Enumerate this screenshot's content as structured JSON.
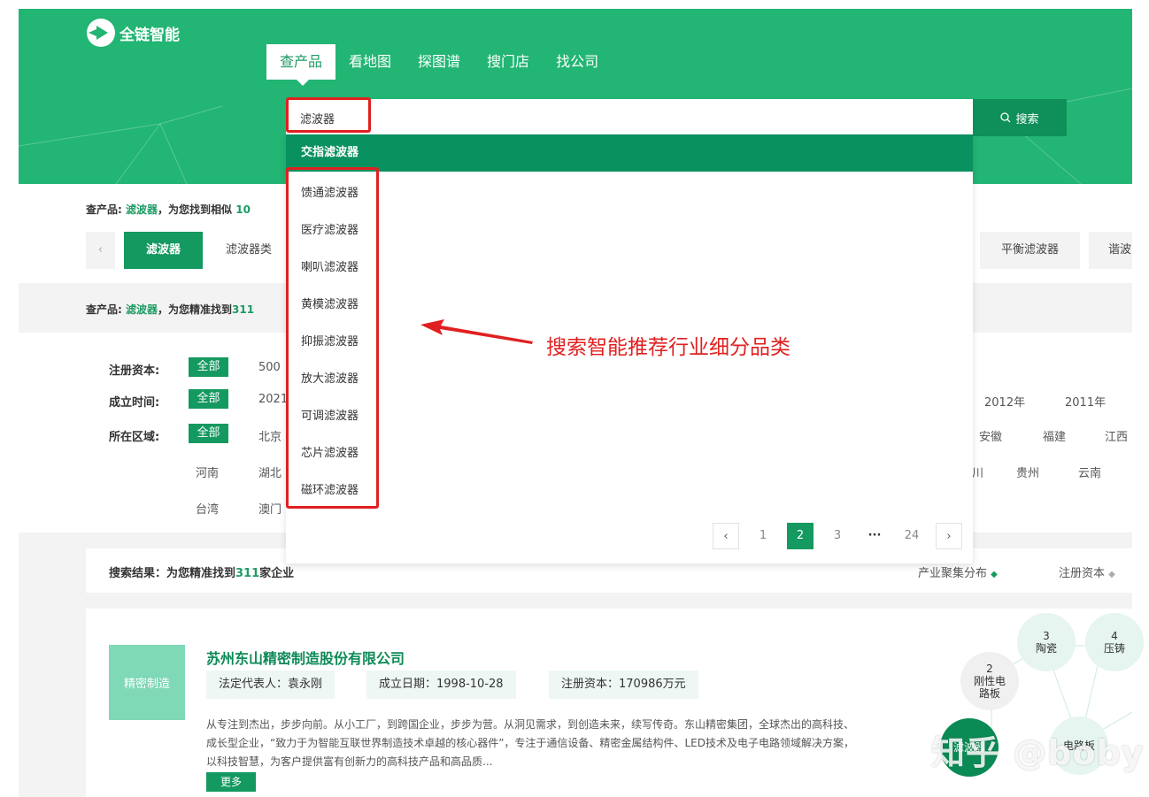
{
  "brand": {
    "logo_text": "全链智能",
    "accent": "#22b573",
    "dark_accent": "#149960",
    "annotation_color": "#e02020"
  },
  "nav": {
    "tabs": [
      "查产品",
      "看地图",
      "探图谱",
      "搜门店",
      "找公司"
    ]
  },
  "search": {
    "value": "滤波器",
    "button_label": "搜索"
  },
  "dropdown": {
    "highlighted": "交指滤波器",
    "items": [
      "馈通滤波器",
      "医疗滤波器",
      "喇叭滤波器",
      "黄模滤波器",
      "抑振滤波器",
      "放大滤波器",
      "可调滤波器",
      "芯片滤波器",
      "磁环滤波器"
    ],
    "pagination": {
      "pages": [
        "1",
        "2",
        "3",
        "···",
        "24"
      ],
      "current": "2"
    }
  },
  "annotation": {
    "text": "搜索智能推荐行业细分品类"
  },
  "summary1": {
    "prefix": "查产品:",
    "keyword": "滤波器",
    "text": "，为您找到相似",
    "count": "10"
  },
  "chips": {
    "left": [
      "滤波器",
      "滤波器类"
    ],
    "right": [
      "平衡滤波器",
      "谐波"
    ]
  },
  "summary2": {
    "prefix": "查产品:",
    "keyword": "滤波器",
    "text": "，为您精准找到",
    "count": "311"
  },
  "filters": {
    "capital": {
      "label": "注册资本:",
      "all": "全部",
      "first": "500"
    },
    "founded": {
      "label": "成立时间:",
      "all": "全部",
      "first": "2021",
      "right": [
        "2012年",
        "2011年"
      ]
    },
    "region": {
      "label": "所在区域:",
      "all": "全部",
      "first": "北京",
      "right": [
        "安徽",
        "福建",
        "江西"
      ],
      "row2": [
        "河南",
        "湖北"
      ],
      "row2_right": [
        "川",
        "贵州",
        "云南"
      ],
      "row3": [
        "台湾",
        "澳门"
      ]
    }
  },
  "results": {
    "text": "搜索结果：为您精准找到",
    "count": "311",
    "unit": "家企业",
    "sort1": "产业聚集分布",
    "sort2": "注册资本"
  },
  "company": {
    "tag": "精密制造",
    "name": "苏州东山精密制造股份有限公司",
    "legal": "法定代表人：袁永刚",
    "date": "成立日期：1998-10-28",
    "capital": "注册资本：170986万元",
    "desc": "从专注到杰出，步步向前。从小工厂，到跨国企业，步步为营。从洞见需求，到创造未来，续写传奇。东山精密集团，全球杰出的高科技、成长型企业，“致力于为智能互联世界制造技术卓越的核心器件”，专注于通信设备、精密金属结构件、LED技术及电子电路领域解决方案，以科技智慧，为客户提供富有创新力的高科技产品和高品质...",
    "more": "更多"
  },
  "bubbles": [
    {
      "num": "3",
      "label": "陶瓷"
    },
    {
      "num": "4",
      "label": "压铸"
    },
    {
      "num": "2",
      "label": "刚性电路板"
    },
    {
      "num": "",
      "label": "滤波器"
    },
    {
      "num": "",
      "label": "电路板"
    }
  ],
  "watermark": "知乎 @boby"
}
